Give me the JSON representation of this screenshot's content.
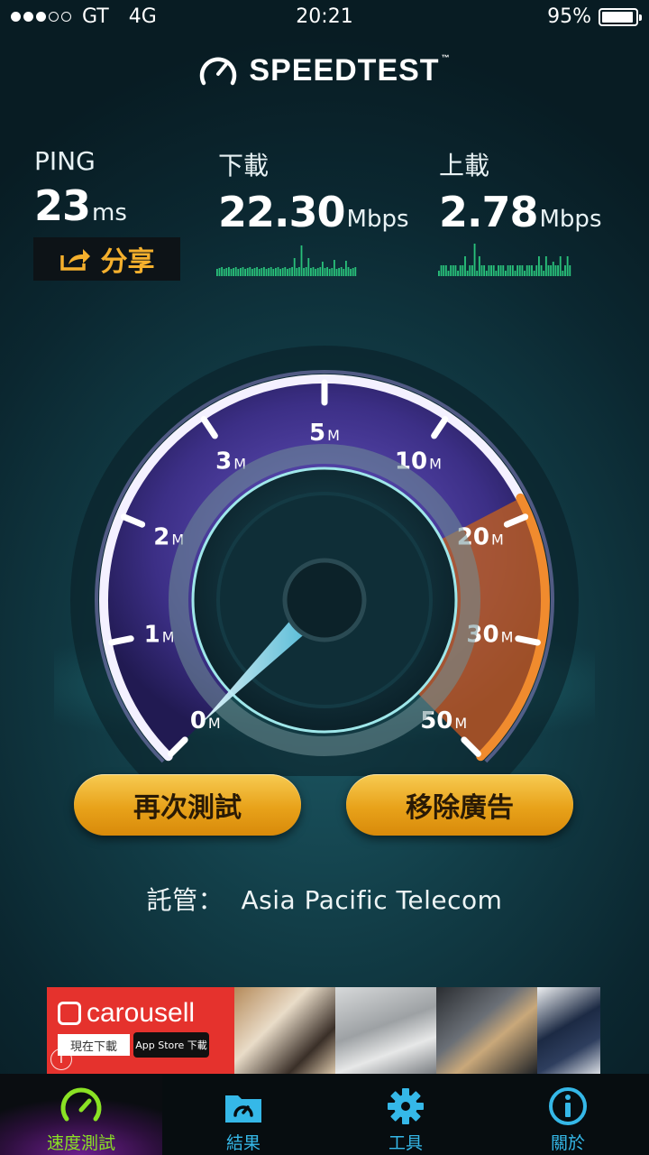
{
  "status_bar": {
    "carrier": "GT",
    "network": "4G",
    "time": "20:21",
    "battery_text": "95%",
    "battery_level": 0.95,
    "signal_strength": 3,
    "signal_max": 5
  },
  "app": {
    "logo_text": "SPEEDTEST",
    "logo_mark": "™"
  },
  "metrics": {
    "ping": {
      "label": "PING",
      "value": "23",
      "unit": "ms"
    },
    "download": {
      "label": "下載",
      "value": "22.30",
      "unit": "Mbps"
    },
    "upload": {
      "label": "上載",
      "value": "2.78",
      "unit": "Mbps"
    }
  },
  "share": {
    "label": "分享",
    "icon": "share-icon"
  },
  "gauge": {
    "ticks": [
      {
        "num": "0",
        "unit": "M"
      },
      {
        "num": "1",
        "unit": "M"
      },
      {
        "num": "2",
        "unit": "M"
      },
      {
        "num": "3",
        "unit": "M"
      },
      {
        "num": "5",
        "unit": "M"
      },
      {
        "num": "10",
        "unit": "M"
      },
      {
        "num": "20",
        "unit": "M"
      },
      {
        "num": "30",
        "unit": "M"
      },
      {
        "num": "50",
        "unit": "M"
      }
    ],
    "needle_value": 0
  },
  "buttons": {
    "retest": "再次測試",
    "remove_ads": "移除廣告"
  },
  "host": {
    "label": "託管：",
    "name": "Asia Pacific Telecom"
  },
  "ad": {
    "brand": "carousell",
    "download_label": "現在下載",
    "store_label": "App Store 下載",
    "info": "i"
  },
  "tabs": [
    {
      "label": "速度測試",
      "icon": "speedometer-icon",
      "active": true
    },
    {
      "label": "結果",
      "icon": "results-folder-icon",
      "active": false
    },
    {
      "label": "工具",
      "icon": "gear-icon",
      "active": false
    },
    {
      "label": "關於",
      "icon": "info-icon",
      "active": false
    }
  ],
  "colors": {
    "accent_orange": "#f5b02d",
    "gauge_purple": "#4b3a9a",
    "gauge_orange": "#e8721a",
    "tab_active": "#8ae224",
    "tab_inactive": "#35b8e8"
  }
}
